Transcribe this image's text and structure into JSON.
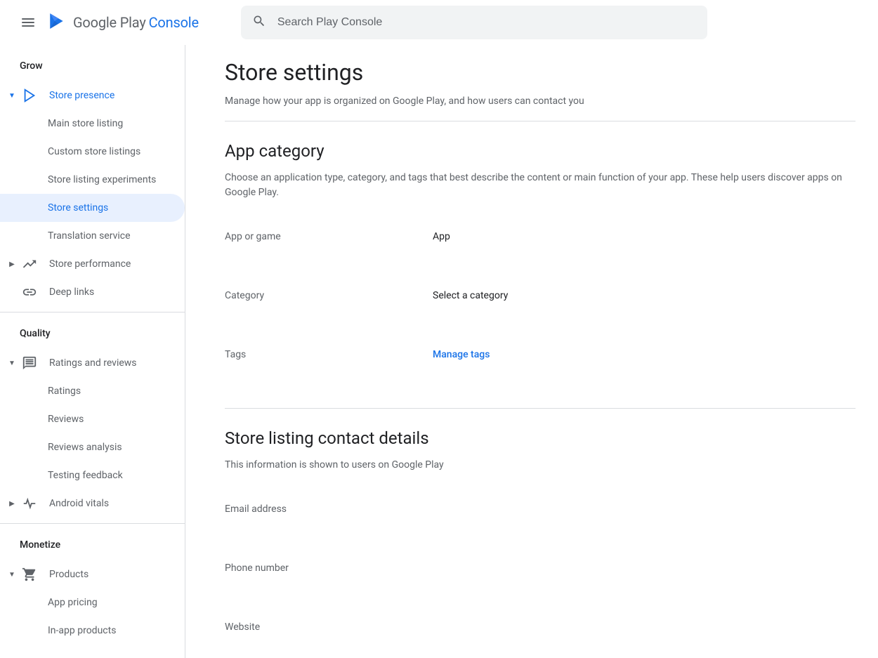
{
  "header": {
    "logo_google": "Google",
    "logo_play": "Play",
    "logo_console": "Console",
    "search_placeholder": "Search Play Console"
  },
  "sidebar": {
    "sections": [
      {
        "header": "Grow",
        "items": [
          {
            "label": "Store presence",
            "icon": "play",
            "expanded": true,
            "level": 0,
            "chevron": "down",
            "children": [
              {
                "label": "Main store listing"
              },
              {
                "label": "Custom store listings"
              },
              {
                "label": "Store listing experiments"
              },
              {
                "label": "Store settings",
                "active": true
              },
              {
                "label": "Translation service"
              }
            ]
          },
          {
            "label": "Store performance",
            "icon": "trending",
            "level": 0,
            "chevron": "right"
          },
          {
            "label": "Deep links",
            "icon": "link",
            "level": 0
          }
        ]
      },
      {
        "header": "Quality",
        "items": [
          {
            "label": "Ratings and reviews",
            "icon": "comment",
            "level": 0,
            "chevron": "down",
            "children": [
              {
                "label": "Ratings"
              },
              {
                "label": "Reviews"
              },
              {
                "label": "Reviews analysis"
              },
              {
                "label": "Testing feedback"
              }
            ]
          },
          {
            "label": "Android vitals",
            "icon": "vitals",
            "level": 0,
            "chevron": "right"
          }
        ]
      },
      {
        "header": "Monetize",
        "items": [
          {
            "label": "Products",
            "icon": "cart",
            "level": 0,
            "chevron": "down",
            "children": [
              {
                "label": "App pricing"
              },
              {
                "label": "In-app products"
              }
            ]
          }
        ]
      }
    ]
  },
  "main": {
    "title": "Store settings",
    "subtitle": "Manage how your app is organized on Google Play, and how users can contact you",
    "section1": {
      "title": "App category",
      "desc": "Choose an application type, category, and tags that best describe the content or main function of your app. These help users discover apps on Google Play.",
      "rows": [
        {
          "label": "App or game",
          "value": "App"
        },
        {
          "label": "Category",
          "value": "Select a category"
        },
        {
          "label": "Tags",
          "link": "Manage tags"
        }
      ]
    },
    "section2": {
      "title": "Store listing contact details",
      "desc": "This information is shown to users on Google Play",
      "rows": [
        {
          "label": "Email address"
        },
        {
          "label": "Phone number"
        },
        {
          "label": "Website"
        }
      ]
    }
  }
}
